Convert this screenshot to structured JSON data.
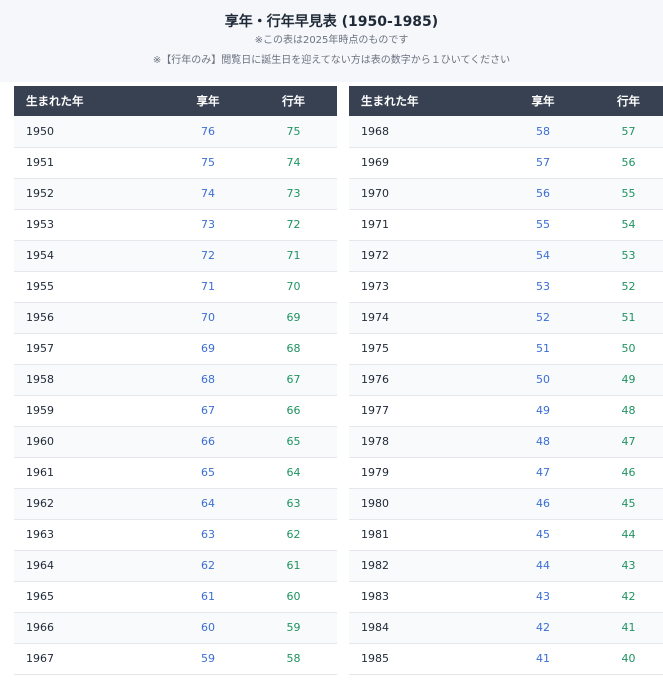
{
  "title": "享年・行年早見表 (1950-1985)",
  "note1": "※この表は2025年時点のものです",
  "note2": "※【行年のみ】閲覧日に誕生日を迎えてない方は表の数字から１ひいてください",
  "columns": {
    "birth_year": "生まれた年",
    "kyonen": "享年",
    "gyonen": "行年"
  },
  "colors": {
    "header_bg": "#374151",
    "kyonen": "#3b6fd4",
    "gyonen": "#1e9360"
  },
  "left_rows": [
    {
      "year": "1950",
      "kyonen": "76",
      "gyonen": "75"
    },
    {
      "year": "1951",
      "kyonen": "75",
      "gyonen": "74"
    },
    {
      "year": "1952",
      "kyonen": "74",
      "gyonen": "73"
    },
    {
      "year": "1953",
      "kyonen": "73",
      "gyonen": "72"
    },
    {
      "year": "1954",
      "kyonen": "72",
      "gyonen": "71"
    },
    {
      "year": "1955",
      "kyonen": "71",
      "gyonen": "70"
    },
    {
      "year": "1956",
      "kyonen": "70",
      "gyonen": "69"
    },
    {
      "year": "1957",
      "kyonen": "69",
      "gyonen": "68"
    },
    {
      "year": "1958",
      "kyonen": "68",
      "gyonen": "67"
    },
    {
      "year": "1959",
      "kyonen": "67",
      "gyonen": "66"
    },
    {
      "year": "1960",
      "kyonen": "66",
      "gyonen": "65"
    },
    {
      "year": "1961",
      "kyonen": "65",
      "gyonen": "64"
    },
    {
      "year": "1962",
      "kyonen": "64",
      "gyonen": "63"
    },
    {
      "year": "1963",
      "kyonen": "63",
      "gyonen": "62"
    },
    {
      "year": "1964",
      "kyonen": "62",
      "gyonen": "61"
    },
    {
      "year": "1965",
      "kyonen": "61",
      "gyonen": "60"
    },
    {
      "year": "1966",
      "kyonen": "60",
      "gyonen": "59"
    },
    {
      "year": "1967",
      "kyonen": "59",
      "gyonen": "58"
    }
  ],
  "right_rows": [
    {
      "year": "1968",
      "kyonen": "58",
      "gyonen": "57"
    },
    {
      "year": "1969",
      "kyonen": "57",
      "gyonen": "56"
    },
    {
      "year": "1970",
      "kyonen": "56",
      "gyonen": "55"
    },
    {
      "year": "1971",
      "kyonen": "55",
      "gyonen": "54"
    },
    {
      "year": "1972",
      "kyonen": "54",
      "gyonen": "53"
    },
    {
      "year": "1973",
      "kyonen": "53",
      "gyonen": "52"
    },
    {
      "year": "1974",
      "kyonen": "52",
      "gyonen": "51"
    },
    {
      "year": "1975",
      "kyonen": "51",
      "gyonen": "50"
    },
    {
      "year": "1976",
      "kyonen": "50",
      "gyonen": "49"
    },
    {
      "year": "1977",
      "kyonen": "49",
      "gyonen": "48"
    },
    {
      "year": "1978",
      "kyonen": "48",
      "gyonen": "47"
    },
    {
      "year": "1979",
      "kyonen": "47",
      "gyonen": "46"
    },
    {
      "year": "1980",
      "kyonen": "46",
      "gyonen": "45"
    },
    {
      "year": "1981",
      "kyonen": "45",
      "gyonen": "44"
    },
    {
      "year": "1982",
      "kyonen": "44",
      "gyonen": "43"
    },
    {
      "year": "1983",
      "kyonen": "43",
      "gyonen": "42"
    },
    {
      "year": "1984",
      "kyonen": "42",
      "gyonen": "41"
    },
    {
      "year": "1985",
      "kyonen": "41",
      "gyonen": "40"
    }
  ]
}
